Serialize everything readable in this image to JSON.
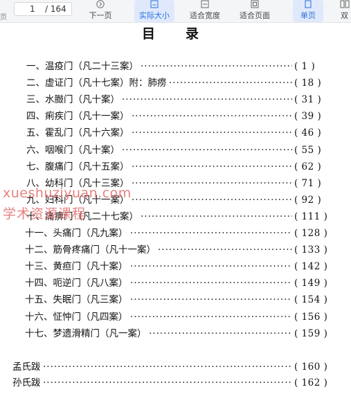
{
  "toolbar": {
    "cut_left_label": "页",
    "page_current": "1",
    "page_total": "/ 164",
    "buttons": {
      "next_page": "下一页",
      "actual_size": "实际大小",
      "fit_width": "适合宽度",
      "fit_page": "适合页面",
      "single_page": "单页",
      "double_page": "双"
    }
  },
  "document": {
    "title": "目录",
    "entries": [
      {
        "label": "一、温疫门（凡二十三案）",
        "page": "( 1 )"
      },
      {
        "label": "二、虚证门（凡十七案）附：肺痨",
        "page": "( 18 )"
      },
      {
        "label": "三、水臌门（凡十案）",
        "page": "( 31 )"
      },
      {
        "label": "四、痢疾门（凡十一案）",
        "page": "( 39 )"
      },
      {
        "label": "五、霍乱门（凡十六案）",
        "page": "( 46 )"
      },
      {
        "label": "六、咽喉门（凡十案）",
        "page": "( 55 )"
      },
      {
        "label": "七、腹痛门（凡十五案）",
        "page": "( 62 )"
      },
      {
        "label": "八、幼科门（凡十三案）",
        "page": "( 71 )"
      },
      {
        "label": "九、妇科门（凡十一案）",
        "page": "( 92 )"
      },
      {
        "label": "十、痛痹门（凡二十七案）",
        "page": "( 111 )"
      },
      {
        "label": "十一、头痛门（凡九案）",
        "page": "( 128 )"
      },
      {
        "label": "十二、筋骨疼痛门（凡十一案）",
        "page": "( 133 )"
      },
      {
        "label": "十三、黄疸门（凡十案）",
        "page": "( 142 )"
      },
      {
        "label": "十四、呃逆门（凡八案）",
        "page": "( 149 )"
      },
      {
        "label": "十五、失眠门（凡三案）",
        "page": "( 154 )"
      },
      {
        "label": "十六、怔忡门（凡四案）",
        "page": "( 156 )"
      },
      {
        "label": "十七、梦遗滑精门（凡一案）",
        "page": "( 159 )"
      },
      {
        "label": "孟氏跋",
        "page": "( 160 )"
      },
      {
        "label": "孙氏跋",
        "page": "( 162 )"
      }
    ]
  },
  "watermark": {
    "line1": "xueshuziyuan.com",
    "line2": "学术资源课程"
  }
}
